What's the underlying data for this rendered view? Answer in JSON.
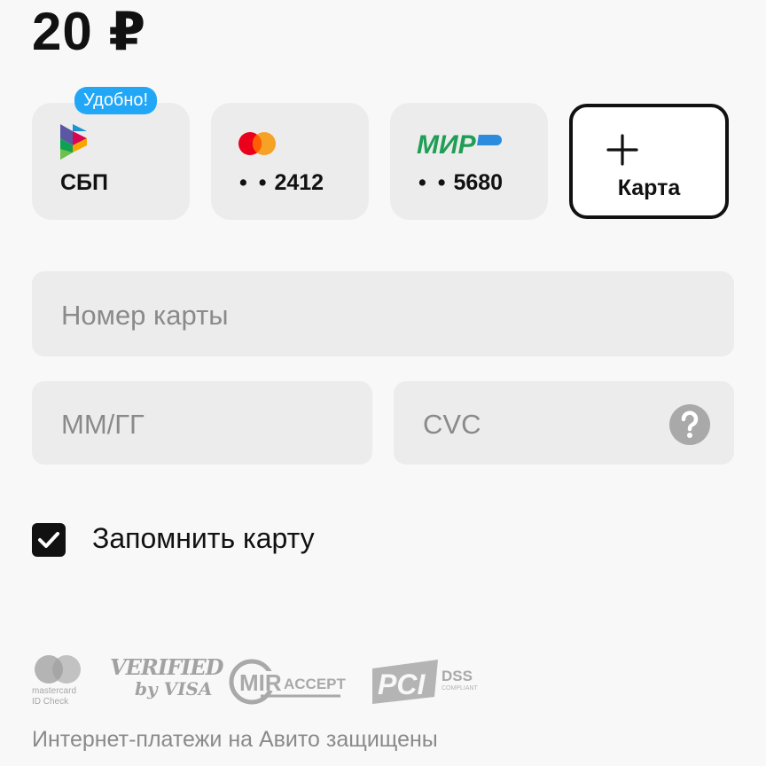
{
  "amount": "20 ₽",
  "payment_methods": {
    "badge": "Удобно!",
    "sbp": {
      "label": "СБП",
      "icon": "sbp-icon"
    },
    "card1": {
      "dots": "• •",
      "last4": "2412",
      "icon": "mastercard-icon"
    },
    "card2": {
      "logo_text": "МИР",
      "dots": "• •",
      "last4": "5680",
      "icon": "mir-icon"
    },
    "add_card": {
      "label": "Карта",
      "icon": "plus-icon"
    }
  },
  "form": {
    "card_number_placeholder": "Номер карты",
    "expiry_placeholder": "ММ/ГГ",
    "cvc_placeholder": "CVC",
    "help_icon": "question-circle-icon",
    "remember_label": "Запомнить карту",
    "remember_checked": true
  },
  "security_logos": {
    "mastercard_caption_1": "mastercard",
    "mastercard_caption_2": "ID Check",
    "visa_line_1": "VERIFIED",
    "visa_line_2": "by VISA",
    "mir_text": "MIR",
    "mir_accept": "ACCEPT",
    "pci_text": "PCI",
    "dss_text": "DSS",
    "dss_sub": "COMPLIANT"
  },
  "footer_text": "Интернет-платежи на Авито защищены",
  "colors": {
    "background": "#f8f8f8",
    "tile": "#ececec",
    "badge": "#22a7f7",
    "mir_green": "#1f9e55",
    "mastercard_red": "#eb001b",
    "mastercard_orange": "#f79e1b",
    "text_primary": "#111111",
    "text_muted": "#8a8a8a"
  }
}
